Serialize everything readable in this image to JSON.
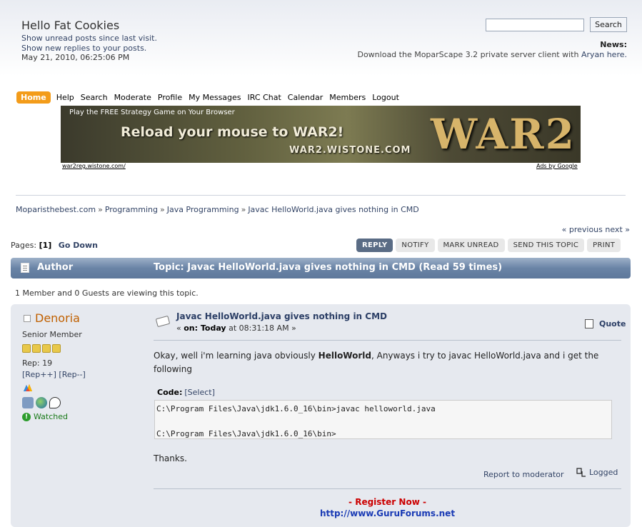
{
  "header": {
    "site_title": "Hello Fat Cookies",
    "unread_link": "Show unread posts since last visit.",
    "replies_link": "Show new replies to your posts.",
    "date": "May 21, 2010, 06:25:06 PM",
    "search_value": "",
    "search_button": "Search",
    "news_label": "News:",
    "news_text": "Download the MoparScape 3.2 private server client with ",
    "news_link": "Aryan here."
  },
  "menu": {
    "items": [
      "Home",
      "Help",
      "Search",
      "Moderate",
      "Profile",
      "My Messages",
      "IRC Chat",
      "Calendar",
      "Members",
      "Logout"
    ]
  },
  "ad": {
    "tagline": "Play the FREE Strategy Game on Your Browser",
    "headline": "Reload your mouse to WAR2!",
    "site": "WAR2.WISTONE.COM",
    "logo": "WAR2",
    "display_url": "war2reg.wistone.com/",
    "ads_by": "Ads by Google"
  },
  "breadcrumb": [
    "Moparisthebest.com",
    "Programming",
    "Java Programming",
    "Javac HelloWorld.java gives nothing in CMD"
  ],
  "breadcrumb_sep": "»",
  "nav": {
    "previous": "« previous",
    "next": "next »",
    "pages_label": "Pages: ",
    "current_page": "[1]",
    "go_down": "Go Down"
  },
  "topic_buttons": [
    "REPLY",
    "NOTIFY",
    "MARK UNREAD",
    "SEND THIS TOPIC",
    "PRINT"
  ],
  "topic_header": {
    "author": "Author",
    "topic": "Topic: Javac HelloWorld.java gives nothing in CMD  (Read 59 times)"
  },
  "viewing": "1 Member and 0 Guests are viewing this topic.",
  "post": {
    "poster_name": "Denoria",
    "rank": "Senior Member",
    "rep": "Rep: 19",
    "rep_plus": "[Rep++]",
    "rep_minus": "[Rep--]",
    "watched": "Watched",
    "subject": "Javac HelloWorld.java gives nothing in CMD",
    "date_prefix": "« ",
    "date_on": "on: Today",
    "date_time": " at 08:31:18 AM »",
    "quote": "Quote",
    "body_start": "Okay, well i'm learning java obviously ",
    "body_bold": "HelloWorld",
    "body_end": ", Anyways i try to javac HelloWorld.java and i get the following",
    "code_label": "Code:",
    "code_select": "[Select]",
    "code_text": "C:\\Program Files\\Java\\jdk1.6.0_16\\bin>javac helloworld.java\n\nC:\\Program Files\\Java\\jdk1.6.0_16\\bin>",
    "thanks": "Thanks.",
    "report": "Report to moderator",
    "logged": "Logged",
    "sig_line1": "- Register Now -",
    "sig_line2": "http://www.GuruForums.net"
  },
  "colors": {
    "accent_orange": "#f39c1a",
    "header_bar": "#6a84a6",
    "poster_name": "#c06000",
    "link": "#334466"
  }
}
